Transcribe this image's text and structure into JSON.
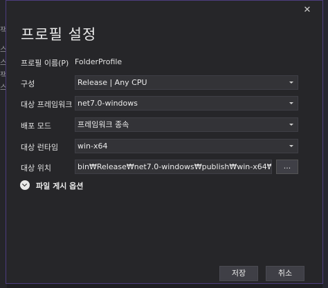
{
  "background": {
    "left_chars": [
      "잭",
      "스",
      "스",
      "잭",
      "스"
    ]
  },
  "dialog": {
    "title": "프로필 설정",
    "close_glyph": "✕"
  },
  "form": {
    "profile_name": {
      "label": "프로필 이름(P)",
      "value": "FolderProfile"
    },
    "configuration": {
      "label": "구성",
      "value": "Release | Any CPU"
    },
    "target_framework": {
      "label": "대상 프레임워크",
      "value": "net7.0-windows"
    },
    "deployment_mode": {
      "label": "배포 모드",
      "value": "프레임워크 종속"
    },
    "target_runtime": {
      "label": "대상 런타임",
      "value": "win-x64"
    },
    "target_location": {
      "label": "대상 위치",
      "value": "bin₩Release₩net7.0-windows₩publish₩win-x64₩",
      "browse_label": "..."
    }
  },
  "expander": {
    "label": "파일 게시 옵션",
    "icon": "chevron-down-icon"
  },
  "buttons": {
    "save": "저장",
    "cancel": "취소"
  },
  "colors": {
    "dialog_bg": "#262629",
    "border_accent": "#4e3d80",
    "input_bg": "#333337"
  }
}
